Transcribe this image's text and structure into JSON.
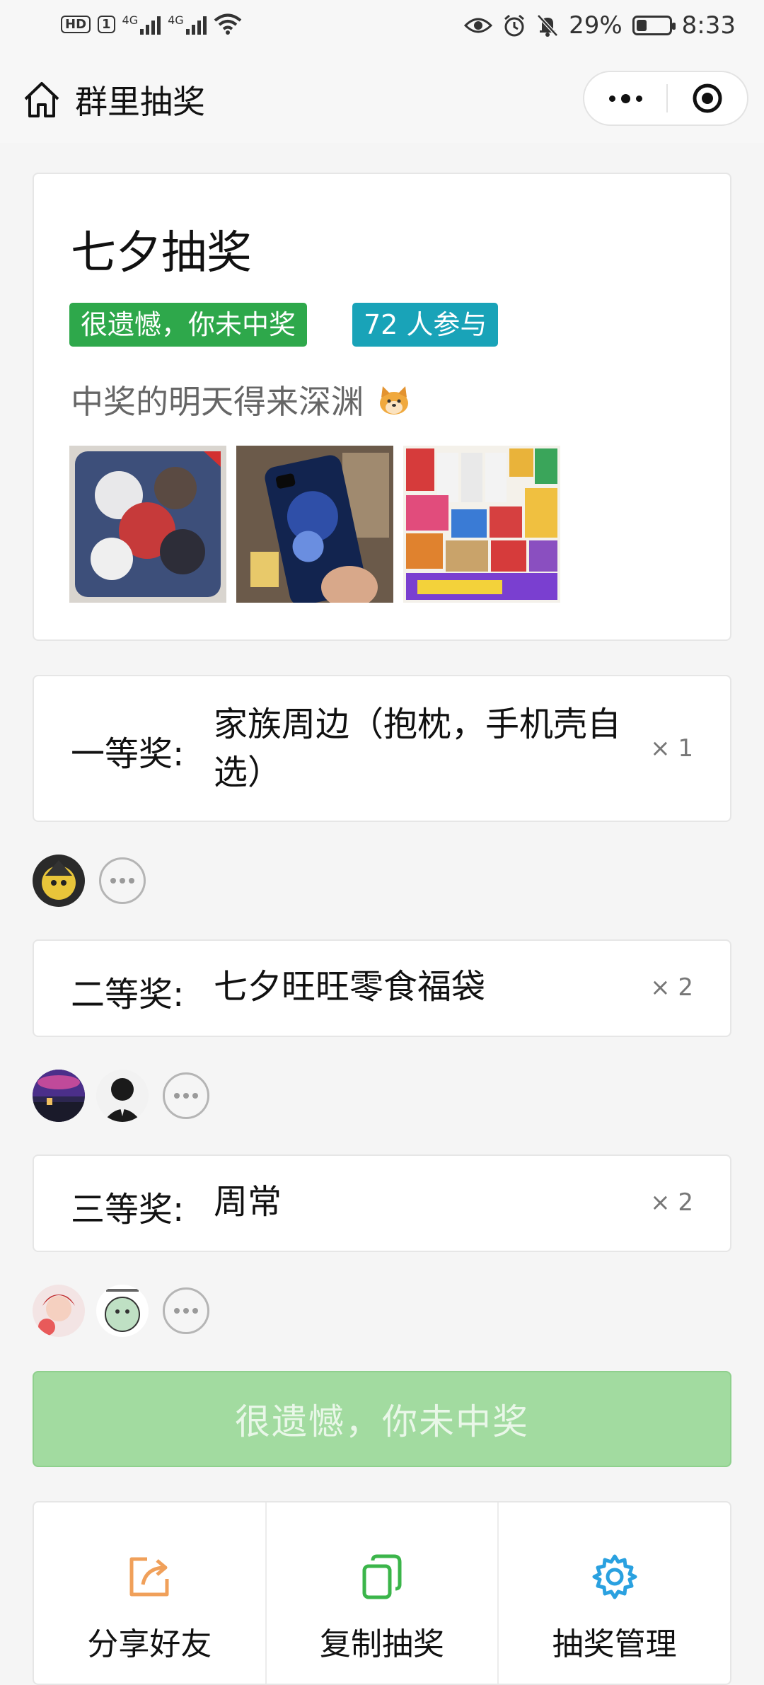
{
  "status_bar": {
    "hd": "HD",
    "sim": "1",
    "net1": "4G",
    "net2": "4G",
    "battery_percent": "29%",
    "battery_level": 0.29,
    "time": "8:33"
  },
  "nav": {
    "title": "群里抽奖"
  },
  "lottery": {
    "title": "七夕抽奖",
    "result_tag": "很遗憾，你未中奖",
    "participants_tag": "72 人参与",
    "description": "中奖的明天得来深渊"
  },
  "prizes": [
    {
      "name": "一等奖:",
      "desc": "家族周边（抱枕，手机壳自选）",
      "count": "× 1"
    },
    {
      "name": "二等奖:",
      "desc": "七夕旺旺零食福袋",
      "count": "× 2"
    },
    {
      "name": "三等奖:",
      "desc": "周常",
      "count": "× 2"
    }
  ],
  "result_button": "很遗憾，你未中奖",
  "actions": [
    {
      "label": "分享好友",
      "icon": "share-icon",
      "color": "#f0a05a"
    },
    {
      "label": "复制抽奖",
      "icon": "copy-icon",
      "color": "#3bb54a"
    },
    {
      "label": "抽奖管理",
      "icon": "gear-icon",
      "color": "#2aa1e0"
    }
  ],
  "colors": {
    "tag_lost": "#2ea84b",
    "tag_people": "#19a3b8",
    "result_button": "#a2dba0"
  }
}
